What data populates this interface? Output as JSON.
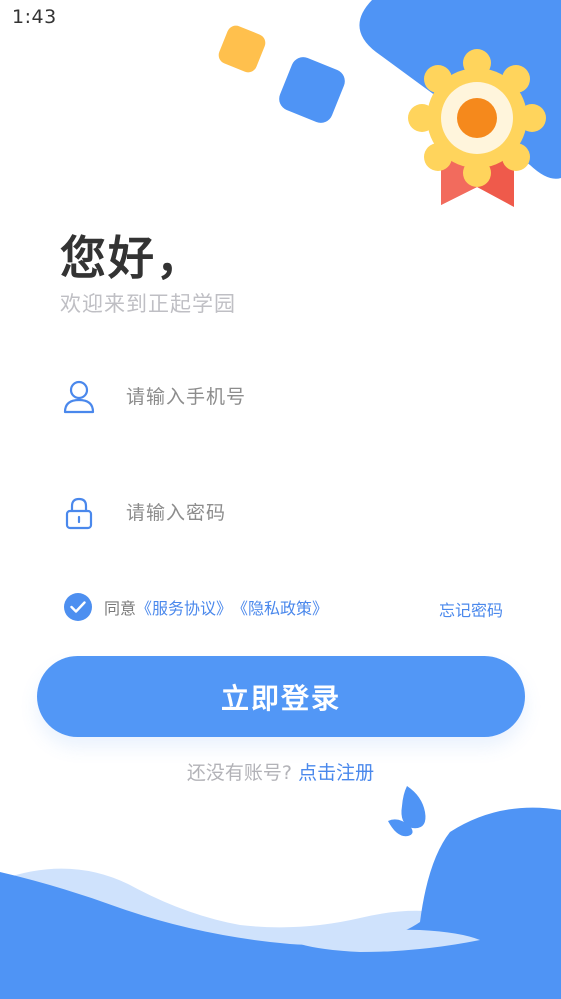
{
  "status_bar": {
    "time": "1:43",
    "icons": [
      "wifi-icon",
      "cellular-signal-icon",
      "battery-charging-icon"
    ]
  },
  "header": {
    "greeting": "您好，",
    "subtitle": "欢迎来到正起学园"
  },
  "form": {
    "phone_placeholder": "请输入手机号",
    "password_placeholder": "请输入密码",
    "phone_icon": "user-icon",
    "password_icon": "lock-icon"
  },
  "agreement": {
    "checked": true,
    "prefix": "同意",
    "service_link": "《服务协议》",
    "privacy_link": "《隐私政策》",
    "forgot_password": "忘记密码"
  },
  "login_button": "立即登录",
  "register": {
    "prompt": "还没有账号?",
    "link": "点击注册"
  },
  "colors": {
    "primary": "#5297f6",
    "link": "#4a88ec",
    "title": "#333333",
    "subtitle": "#bfbfc4",
    "badge_yellow": "#ffd45c",
    "badge_orange": "#f5891c",
    "ribbon_red": "#ef5a4b",
    "deco_light_blue": "#cfe2fc"
  }
}
